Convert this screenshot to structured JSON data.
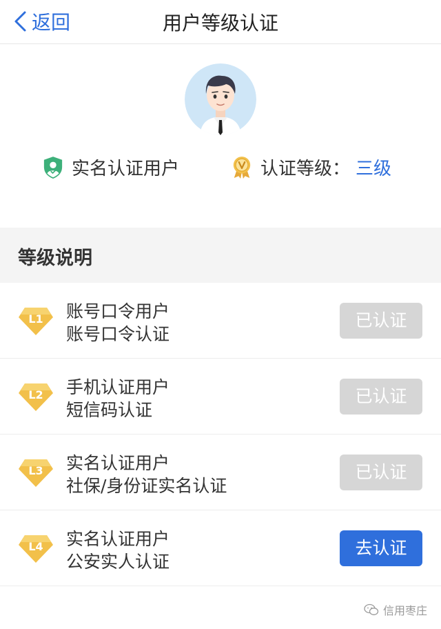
{
  "header": {
    "back_label": "返回",
    "title": "用户等级认证"
  },
  "profile": {
    "status_label": "实名认证用户",
    "level_label": "认证等级：",
    "level_value": "三级"
  },
  "section": {
    "title": "等级说明"
  },
  "levels": [
    {
      "badge": "L1",
      "title": "账号口令用户",
      "desc": "账号口令认证",
      "action": "已认证",
      "state": "done"
    },
    {
      "badge": "L2",
      "title": "手机认证用户",
      "desc": "短信码认证",
      "action": "已认证",
      "state": "done"
    },
    {
      "badge": "L3",
      "title": "实名认证用户",
      "desc": "社保/身份证实名认证",
      "action": "已认证",
      "state": "done"
    },
    {
      "badge": "L4",
      "title": "实名认证用户",
      "desc": "公安实人认证",
      "action": "去认证",
      "state": "pending"
    }
  ],
  "watermark": {
    "text": "信用枣庄"
  },
  "colors": {
    "accent": "#2f6fdc",
    "disabled_button": "#d6d6d6",
    "badge_gold": "#f2c04a",
    "shield_green": "#3db07a"
  },
  "icons": {
    "back": "chevron-left-icon",
    "status": "shield-user-icon",
    "level": "medal-v-icon",
    "levels": "diamond-level-icon",
    "watermark": "wechat-icon"
  }
}
